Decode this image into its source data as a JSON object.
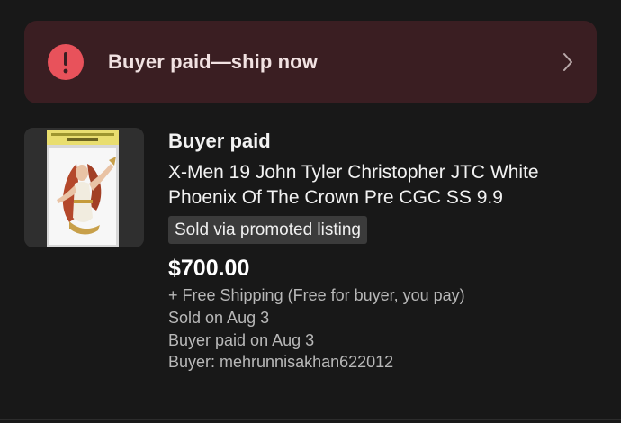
{
  "banner": {
    "icon": "alert-circle-icon",
    "message": "Buyer paid—ship now",
    "chevron": "chevron-right-icon",
    "colors": {
      "background": "#3a1e22",
      "icon": "#e8525b"
    }
  },
  "order": {
    "thumbnail": "comic-cgc-slab-thumbnail",
    "status": "Buyer paid",
    "title": "X-Men 19 John Tyler Christopher JTC White Phoenix Of The Crown Pre CGC SS 9.9",
    "badge": "Sold via promoted listing",
    "price": "$700.00",
    "shipping": "+ Free Shipping (Free for buyer, you pay)",
    "sold_on": "Sold on Aug 3",
    "paid_on": "Buyer paid on Aug 3",
    "buyer": "Buyer: mehrunnisakhan622012"
  }
}
